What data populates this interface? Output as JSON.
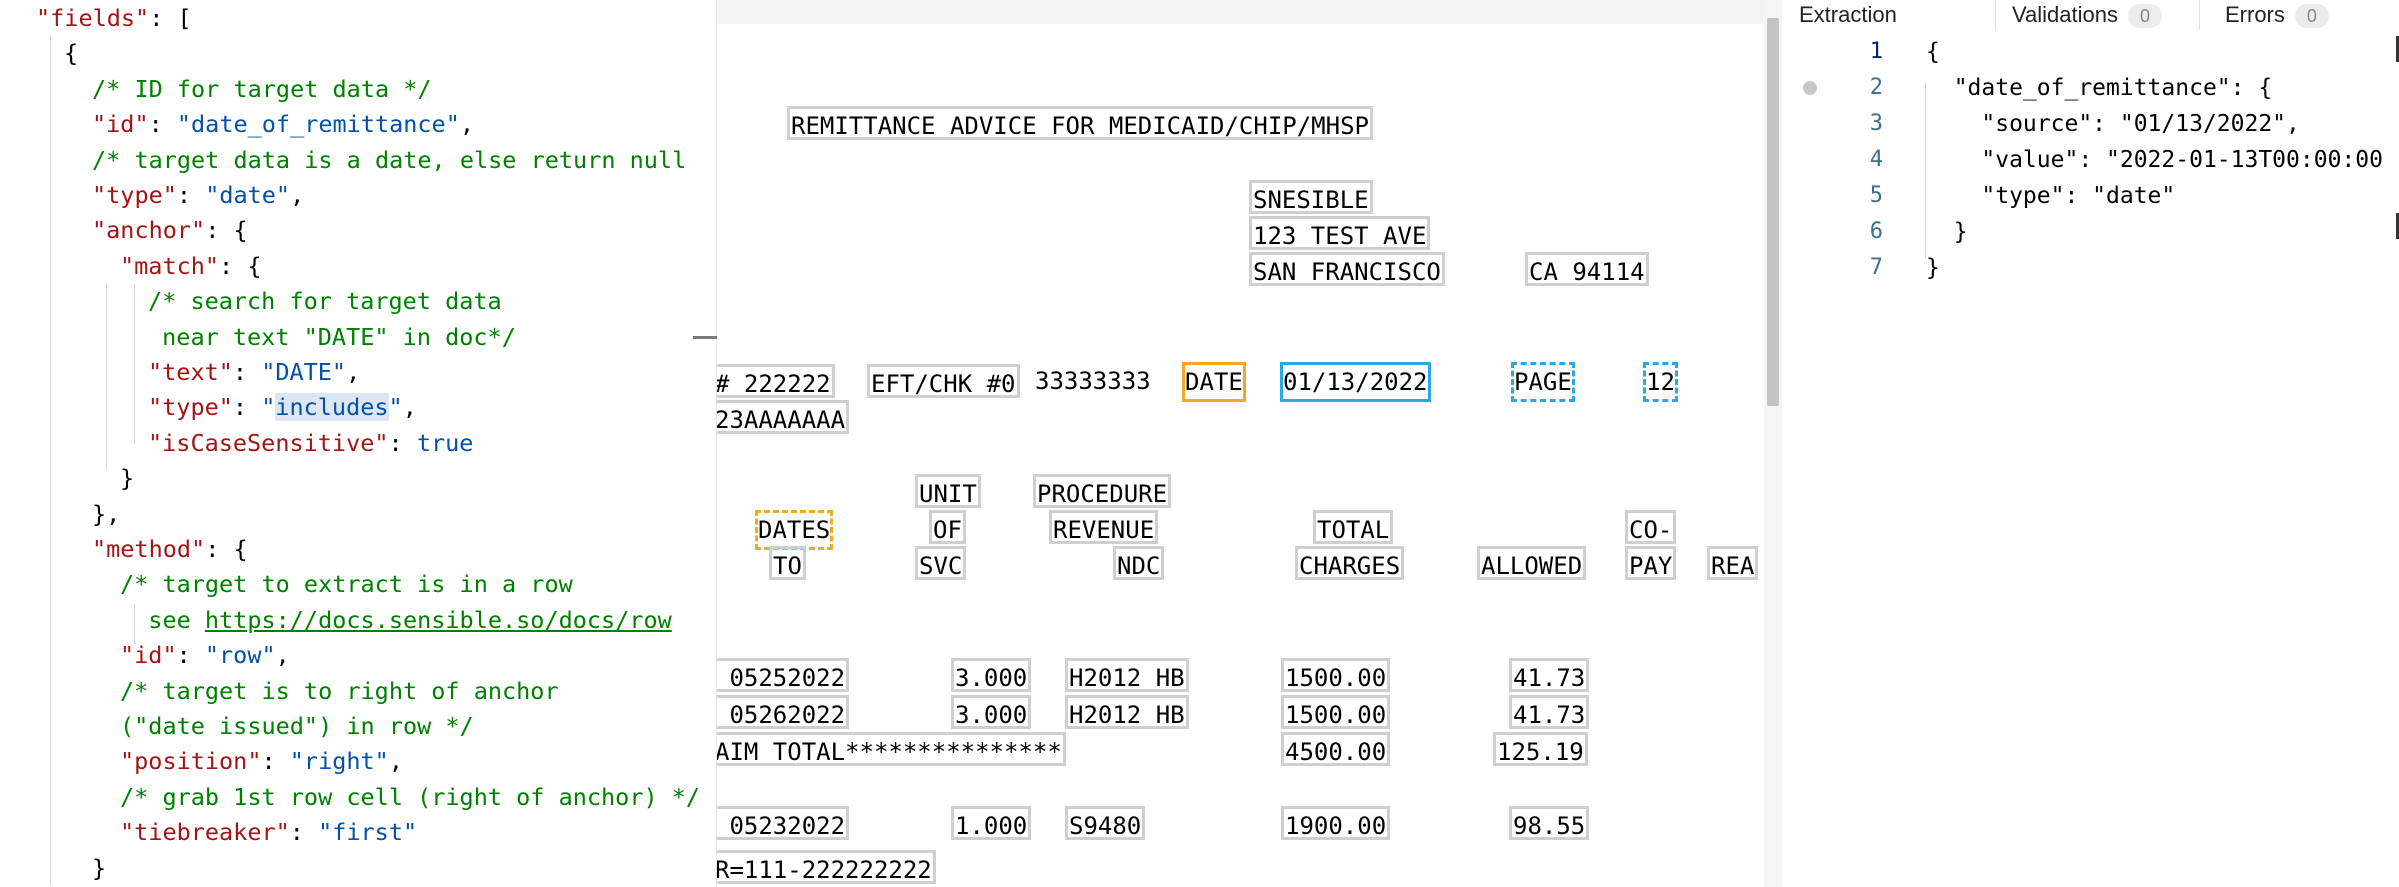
{
  "code_editor": {
    "lines": [
      {
        "indent": 1,
        "tokens": [
          {
            "t": "\"fields\"",
            "c": "key"
          },
          {
            "t": ": [",
            "c": "punc"
          }
        ]
      },
      {
        "indent": 2,
        "tokens": [
          {
            "t": "{",
            "c": "punc"
          }
        ]
      },
      {
        "indent": 3,
        "tokens": [
          {
            "t": "/* ID for target data */",
            "c": "comment"
          }
        ]
      },
      {
        "indent": 3,
        "tokens": [
          {
            "t": "\"id\"",
            "c": "key"
          },
          {
            "t": ": ",
            "c": "punc"
          },
          {
            "t": "\"date_of_remittance\"",
            "c": "str"
          },
          {
            "t": ",",
            "c": "punc"
          }
        ]
      },
      {
        "indent": 3,
        "tokens": [
          {
            "t": "/* target data is a date, else return null",
            "c": "comment"
          }
        ]
      },
      {
        "indent": 3,
        "tokens": [
          {
            "t": "\"type\"",
            "c": "key"
          },
          {
            "t": ": ",
            "c": "punc"
          },
          {
            "t": "\"date\"",
            "c": "str"
          },
          {
            "t": ",",
            "c": "punc"
          }
        ]
      },
      {
        "indent": 3,
        "tokens": [
          {
            "t": "\"anchor\"",
            "c": "key"
          },
          {
            "t": ": {",
            "c": "punc"
          }
        ]
      },
      {
        "indent": 4,
        "tokens": [
          {
            "t": "\"match\"",
            "c": "key"
          },
          {
            "t": ": {",
            "c": "punc"
          }
        ]
      },
      {
        "indent": 5,
        "tokens": [
          {
            "t": "/* search for target data",
            "c": "comment"
          }
        ]
      },
      {
        "indent": 5,
        "tokens": [
          {
            "t": " near text \"DATE\" in doc*/",
            "c": "comment"
          }
        ]
      },
      {
        "indent": 5,
        "tokens": [
          {
            "t": "\"text\"",
            "c": "key"
          },
          {
            "t": ": ",
            "c": "punc"
          },
          {
            "t": "\"DATE\"",
            "c": "str"
          },
          {
            "t": ",",
            "c": "punc"
          }
        ]
      },
      {
        "indent": 5,
        "tokens": [
          {
            "t": "\"type\"",
            "c": "key"
          },
          {
            "t": ": ",
            "c": "punc"
          },
          {
            "t": "\"",
            "c": "str"
          },
          {
            "t": "includes",
            "c": "str sel"
          },
          {
            "t": "\"",
            "c": "str"
          },
          {
            "t": ",",
            "c": "punc"
          }
        ]
      },
      {
        "indent": 5,
        "tokens": [
          {
            "t": "\"isCaseSensitive\"",
            "c": "key"
          },
          {
            "t": ": ",
            "c": "punc"
          },
          {
            "t": "true",
            "c": "kw"
          }
        ]
      },
      {
        "indent": 4,
        "tokens": [
          {
            "t": "}",
            "c": "punc"
          }
        ]
      },
      {
        "indent": 3,
        "tokens": [
          {
            "t": "},",
            "c": "punc"
          }
        ]
      },
      {
        "indent": 3,
        "tokens": [
          {
            "t": "\"method\"",
            "c": "key"
          },
          {
            "t": ": {",
            "c": "punc"
          }
        ]
      },
      {
        "indent": 4,
        "tokens": [
          {
            "t": "/* target to extract is in a row",
            "c": "comment"
          }
        ]
      },
      {
        "indent": 4,
        "tokens": [
          {
            "t": "  see ",
            "c": "comment"
          },
          {
            "t": "https://docs.sensible.so/docs/row",
            "c": "link"
          }
        ]
      },
      {
        "indent": 4,
        "tokens": [
          {
            "t": "\"id\"",
            "c": "key"
          },
          {
            "t": ": ",
            "c": "punc"
          },
          {
            "t": "\"row\"",
            "c": "str"
          },
          {
            "t": ",",
            "c": "punc"
          }
        ]
      },
      {
        "indent": 4,
        "tokens": [
          {
            "t": "/* target is to right of anchor",
            "c": "comment"
          }
        ]
      },
      {
        "indent": 4,
        "tokens": [
          {
            "t": "(\"date issued\") in row */",
            "c": "comment"
          }
        ]
      },
      {
        "indent": 4,
        "tokens": [
          {
            "t": "\"position\"",
            "c": "key"
          },
          {
            "t": ": ",
            "c": "punc"
          },
          {
            "t": "\"right\"",
            "c": "str"
          },
          {
            "t": ",",
            "c": "punc"
          }
        ]
      },
      {
        "indent": 4,
        "tokens": [
          {
            "t": "/* grab 1st row cell (right of anchor) */",
            "c": "comment"
          }
        ]
      },
      {
        "indent": 4,
        "tokens": [
          {
            "t": "\"tiebreaker\"",
            "c": "key"
          },
          {
            "t": ": ",
            "c": "punc"
          },
          {
            "t": "\"first\"",
            "c": "str"
          }
        ]
      },
      {
        "indent": 3,
        "tokens": [
          {
            "t": "}",
            "c": "punc"
          }
        ]
      }
    ]
  },
  "document": {
    "title": "REMITTANCE ADVICE FOR MEDICAID/CHIP/MHSP",
    "payee_name": "SNESIBLE",
    "payee_street": "123 TEST AVE",
    "payee_city": "SAN FRANCISCO",
    "payee_state_zip": "CA 94114",
    "id_prefix": "# 222222",
    "eft_label": "EFT/CHK #0",
    "eft_number": "33333333",
    "date_label": "DATE",
    "date_value": "01/13/2022",
    "page_label": "PAGE",
    "page_value": "12",
    "account": "23AAAAAAA",
    "headers": {
      "unit": "UNIT",
      "of": "OF",
      "svc": "SVC",
      "procedure": "PROCEDURE",
      "revenue": "REVENUE",
      "ndc": "NDC",
      "dates": "DATES",
      "to": "TO",
      "total": "TOTAL",
      "charges": "CHARGES",
      "allowed": "ALLOWED",
      "co": "CO-",
      "pay": "PAY",
      "rea": "REA"
    },
    "rows": [
      {
        "date": " 05252022",
        "units": "3.000",
        "proc": "H2012 HB",
        "charges": "1500.00",
        "allowed": "41.73"
      },
      {
        "date": " 05262022",
        "units": "3.000",
        "proc": "H2012 HB",
        "charges": "1500.00",
        "allowed": "41.73"
      },
      {
        "date": " 05232022",
        "units": "1.000",
        "proc": "S9480",
        "charges": "1900.00",
        "allowed": "98.55"
      }
    ],
    "claim_total_label": "AIM TOTAL***************",
    "claim_total_charges": "4500.00",
    "claim_total_allowed": "125.19",
    "footer_id": "R=111-222222222"
  },
  "extraction_panel": {
    "tabs": [
      {
        "label": "Extraction"
      },
      {
        "label": "Validations",
        "badge": "0"
      },
      {
        "label": "Errors",
        "badge": "0"
      }
    ],
    "line_numbers": [
      "1",
      "2",
      "3",
      "4",
      "5",
      "6",
      "7"
    ],
    "output_lines": [
      "{",
      "  \"date_of_remittance\": {",
      "    \"source\": \"01/13/2022\",",
      "    \"value\": \"2022-01-13T00:00:00",
      "    \"type\": \"date\"",
      "  }",
      "}"
    ]
  }
}
